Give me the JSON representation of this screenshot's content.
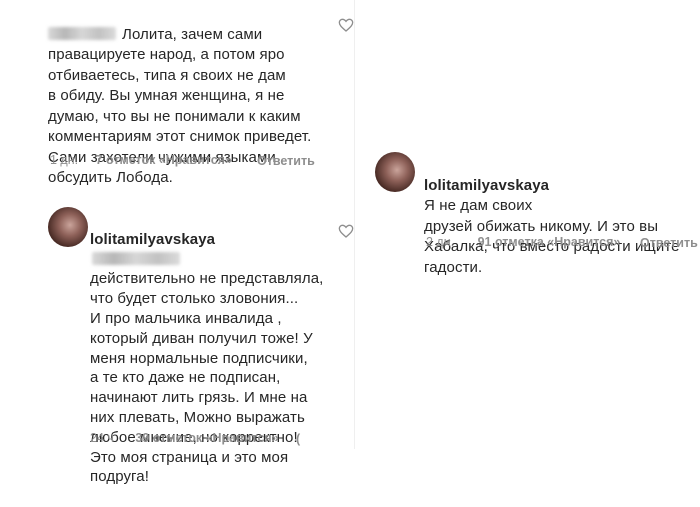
{
  "comments": [
    {
      "username": "",
      "text": "Лолита, зачем сами\nправацируете народ, а потом яро\nотбиваетесь, типа я своих не дам\nв обиду. Вы умная женщина, я не\nдумаю, что вы не понимали к каким\nкомментариям этот снимок приведет.\nСами захотели чужими языками\nобсудить Лобода.",
      "time": "1 дн.",
      "likes": "7 отметок «Нравится»",
      "reply": "Ответить"
    },
    {
      "username": "lolitamilyavskaya",
      "text": "действительно не представляла,\nчто будет столько зловония...\nИ про мальчика инвалида ,\nкоторый диван получил тоже! У\nменя нормальные подписчики,\nа те кто даже не подписан,\nначинают лить грязь. И мне на\nних плевать, Можно выражать\nлюбое мнение, но корректно!\nЭто моя страница  и это моя\nподруга!",
      "time": "24 ч",
      "likes": "39 отметок «Нравится»"
    },
    {
      "username": "lolitamilyavskaya",
      "text": "Я не дам своих\nдрузей обижать никому. И это вы\nХабалка, что вместо радости ищите\nгадости.",
      "time": "2 дн.",
      "likes": "91 отметка «Нравится»",
      "reply": "Ответить"
    }
  ],
  "icons": {
    "heart": "heart-outline-icon",
    "avatar": "profile-avatar"
  },
  "colors": {
    "text": "#262626",
    "meta": "#8e8e8e",
    "background": "#ffffff"
  }
}
